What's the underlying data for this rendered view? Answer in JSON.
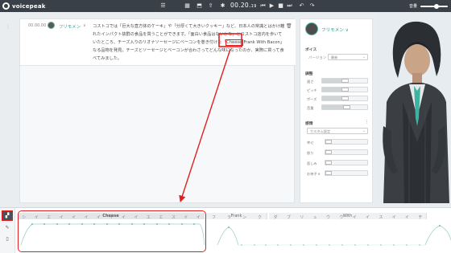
{
  "app": {
    "name": "voicepeak"
  },
  "toolbar": {
    "time_main": "00.20.",
    "time_frac": "19",
    "volume_label": "音量",
    "icons": [
      "menu-icon",
      "grid-icon",
      "dictionary-icon",
      "export-icon",
      "settings-icon",
      "skip-back-icon",
      "play-icon",
      "stop-icon",
      "skip-forward-icon",
      "undo-icon",
      "redo-icon"
    ],
    "volume_level": 0.6
  },
  "block": {
    "timestamp": "00.00.00",
    "speaker": "フリモメン",
    "speaker_caret": "∨",
    "text_before": "コストコでは「巨大な直方体のケーキ」や「分厚くて大きいクッキー」など、日本人の常識とはかけ離れたインパクト抜群の食品を買うことができます。「面白い食品はないかな」とコストコ店内を歩いていたところ、チーズ入りのリオナソーセージにベーコンを巻き付けた「",
    "highlight": "Cheese",
    "text_after": " Frank With Bacon」なる品物を発見。チーズとソーセージとベーコンが合わさってどんな味になったのか、実際に買って食べてみました。"
  },
  "settings": {
    "speaker": "フリモメン",
    "speaker_caret": "∨",
    "voice_section": "ボイス",
    "version_label": "バージョン",
    "version_value": "最新",
    "adjust_section": "調整",
    "sliders": [
      {
        "label": "速さ",
        "value": 0.5
      },
      {
        "label": "ピッチ",
        "value": 0.5
      },
      {
        "label": "ポーズ",
        "value": 0.5
      },
      {
        "label": "音量",
        "value": 0.55
      }
    ],
    "emotion_section": "感情",
    "emotion_preset": "カスタム設定",
    "emotions": [
      {
        "label": "幸せ",
        "value": 0
      },
      {
        "label": "怒り",
        "value": 0
      },
      {
        "label": "悲しみ",
        "value": 0
      },
      {
        "label": "お茶子 e",
        "value": 0
      }
    ]
  },
  "timeline": {
    "tools": [
      "phoneme-icon",
      "pencil-icon",
      "doc-icon"
    ],
    "words": [
      {
        "label": "Cheese",
        "phonemes": [
          "シ",
          "イ",
          "エ",
          "イ",
          "イ",
          "イ",
          "イ",
          "イ",
          "イ",
          "イ",
          "エ",
          "エ",
          "ス",
          "イ",
          "イ"
        ]
      },
      {
        "label": "Frank",
        "phonemes": [
          "フ",
          "ラ",
          "ン",
          "ク"
        ]
      },
      {
        "label": "With",
        "phonemes": [
          "ダ",
          "ブ",
          "リ",
          "ュ",
          "ウ",
          "ウ",
          "イ",
          "イ",
          "ス",
          "イ",
          "イ",
          "チ"
        ]
      }
    ]
  },
  "colors": {
    "accent": "#2a9a8f",
    "annotation": "#e02020",
    "topbar": "#3a4047"
  }
}
